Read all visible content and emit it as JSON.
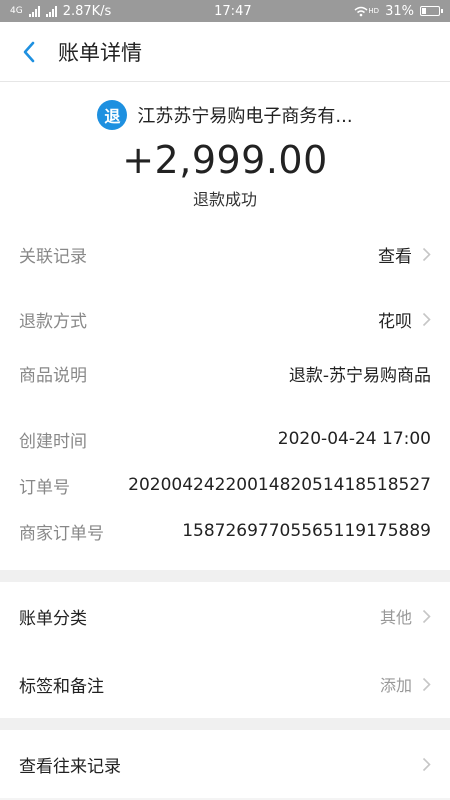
{
  "status_bar": {
    "network": "4G",
    "speed": "2.87K/s",
    "time": "17:47",
    "wifi": "HD",
    "battery": "31%"
  },
  "nav": {
    "title": "账单详情"
  },
  "header": {
    "icon_text": "退",
    "merchant": "江苏苏宁易购电子商务有...",
    "amount": "+2,999.00",
    "status": "退款成功"
  },
  "details": [
    {
      "label": "关联记录",
      "value": "查看"
    },
    {
      "label": "退款方式",
      "value": "花呗"
    },
    {
      "label": "商品说明",
      "value": "退款-苏宁易购商品"
    },
    {
      "label": "创建时间",
      "value": "2020-04-24 17:00"
    },
    {
      "label": "订单号",
      "value": "2020042422001482051418518527"
    },
    {
      "label": "商家订单号",
      "value": "15872697705565119175889"
    }
  ],
  "category": {
    "label": "账单分类",
    "value": "其他"
  },
  "tags": {
    "label": "标签和备注",
    "value": "添加"
  },
  "history": {
    "label": "查看往来记录"
  },
  "colors": {
    "accent": "#1e90e0",
    "statusbar": "#9a9a9a"
  },
  "icons": [
    "back-arrow-icon",
    "refund-icon",
    "chevron-right-icon"
  ]
}
